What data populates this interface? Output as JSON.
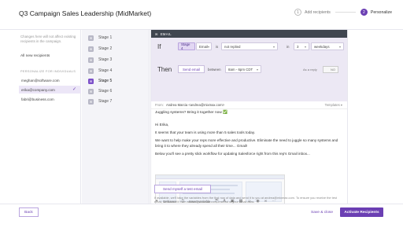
{
  "app": {
    "title": "Q3 Campaign Sales Leadership (MidMarket)"
  },
  "steps": [
    {
      "num": "1",
      "label": "Add recipients"
    },
    {
      "num": "2",
      "label": "Personalize"
    }
  ],
  "sidebar": {
    "note": "Changes here will not affect existing recipients in the campaign.",
    "all_recipients": "All new recipients",
    "section_title": "PERSONALIZE FOR INDIVIDUALS",
    "recipients": [
      "meghan@software.com",
      "erika@company.com",
      "fabri@business.com"
    ]
  },
  "stages": [
    "Stage 1",
    "Stage 2",
    "Stage 3",
    "Stage 4",
    "Stage 5",
    "Stage 6",
    "Stage 7"
  ],
  "editor": {
    "header": "EMAIL",
    "condition": {
      "if_label": "If",
      "stage": "Stage 4",
      "channel": "Email",
      "is_word": "is",
      "status": "not replied",
      "in_word": "in",
      "count": "3",
      "unit": "weekdays"
    },
    "then": {
      "label": "Then",
      "action": "Send email",
      "between_word": "between",
      "time_range": "8am - 6pm CDT",
      "reply_label": "As a reply",
      "reply_value": "NO"
    },
    "from_label": "From:",
    "from_value": "Andrea Marcia <andrea@mixmax.com>",
    "templates_label": "Templates",
    "subject": "Juggling systems? Bring it together now ✅",
    "body": [
      "Hi Erika,",
      "It seems that your team is using more than 5 sales tools today.",
      "We want to help make your reps more effective and productive. Eliminate the need to juggle so many systems and bring it to where they already spend all their time... Gmail!",
      "Below you'll see a pretty slick workflow for updating Salesforce right from this rep's Gmail inbox..."
    ],
    "toolbar": {
      "enhance": "Enhance",
      "insert": "Insert variable"
    },
    "test_button": "Send myself a test email",
    "fine_print": "If available, we'll take the variables from the first row of data and send it to you at andrea@mixmax.com. To ensure you receive the test email, we'll send it from andrea@mixmax.com, instead of your email alias."
  },
  "footer": {
    "back": "Back",
    "save": "Save & close",
    "activate": "Activate Recipients"
  },
  "colors": {
    "accent": "#6b3fb3",
    "header_dark": "#404650",
    "condition_bg": "#ece8f4"
  }
}
